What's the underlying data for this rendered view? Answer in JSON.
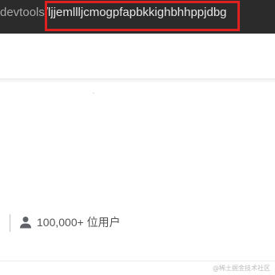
{
  "address_bar": {
    "url_prefix": "devtools",
    "url_path": "/ljjemllljcmogpfapbkkighbhhppjdbg"
  },
  "stats": {
    "icon": "person-icon",
    "users_text": "100,000+ 位用户"
  },
  "watermark": {
    "text": "@稀土掘金技术社区"
  },
  "colors": {
    "address_bar_bg": "#2b2b2b",
    "highlight": "#e02020",
    "text_secondary": "#555555"
  }
}
